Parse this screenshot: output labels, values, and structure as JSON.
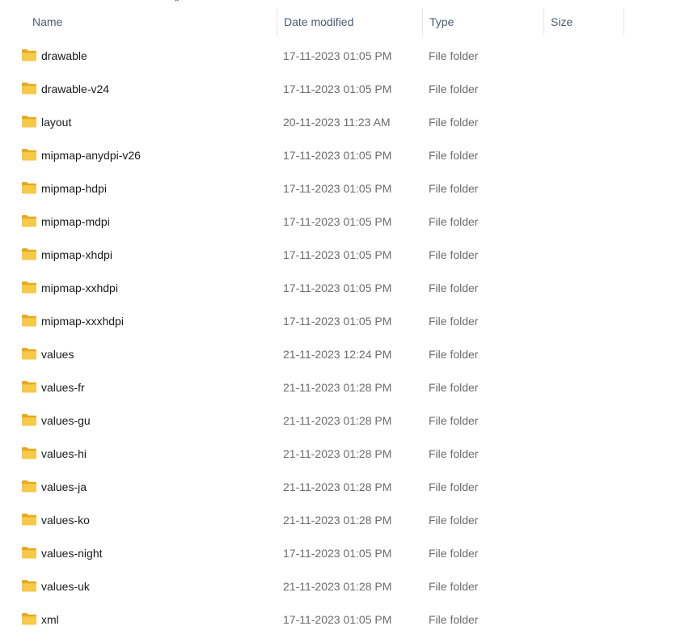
{
  "columns": {
    "name": "Name",
    "date": "Date modified",
    "type": "Type",
    "size": "Size"
  },
  "sort": {
    "column": "name",
    "direction": "ascending",
    "icon": "chevron-up-icon"
  },
  "folder_icon_color": "#F7C948",
  "files": [
    {
      "name": "drawable",
      "date": "17-11-2023 01:05 PM",
      "type": "File folder",
      "size": ""
    },
    {
      "name": "drawable-v24",
      "date": "17-11-2023 01:05 PM",
      "type": "File folder",
      "size": ""
    },
    {
      "name": "layout",
      "date": "20-11-2023 11:23 AM",
      "type": "File folder",
      "size": ""
    },
    {
      "name": "mipmap-anydpi-v26",
      "date": "17-11-2023 01:05 PM",
      "type": "File folder",
      "size": ""
    },
    {
      "name": "mipmap-hdpi",
      "date": "17-11-2023 01:05 PM",
      "type": "File folder",
      "size": ""
    },
    {
      "name": "mipmap-mdpi",
      "date": "17-11-2023 01:05 PM",
      "type": "File folder",
      "size": ""
    },
    {
      "name": "mipmap-xhdpi",
      "date": "17-11-2023 01:05 PM",
      "type": "File folder",
      "size": ""
    },
    {
      "name": "mipmap-xxhdpi",
      "date": "17-11-2023 01:05 PM",
      "type": "File folder",
      "size": ""
    },
    {
      "name": "mipmap-xxxhdpi",
      "date": "17-11-2023 01:05 PM",
      "type": "File folder",
      "size": ""
    },
    {
      "name": "values",
      "date": "21-11-2023 12:24 PM",
      "type": "File folder",
      "size": ""
    },
    {
      "name": "values-fr",
      "date": "21-11-2023 01:28 PM",
      "type": "File folder",
      "size": ""
    },
    {
      "name": "values-gu",
      "date": "21-11-2023 01:28 PM",
      "type": "File folder",
      "size": ""
    },
    {
      "name": "values-hi",
      "date": "21-11-2023 01:28 PM",
      "type": "File folder",
      "size": ""
    },
    {
      "name": "values-ja",
      "date": "21-11-2023 01:28 PM",
      "type": "File folder",
      "size": ""
    },
    {
      "name": "values-ko",
      "date": "21-11-2023 01:28 PM",
      "type": "File folder",
      "size": ""
    },
    {
      "name": "values-night",
      "date": "17-11-2023 01:05 PM",
      "type": "File folder",
      "size": ""
    },
    {
      "name": "values-uk",
      "date": "21-11-2023 01:28 PM",
      "type": "File folder",
      "size": ""
    },
    {
      "name": "xml",
      "date": "17-11-2023 01:05 PM",
      "type": "File folder",
      "size": ""
    }
  ]
}
